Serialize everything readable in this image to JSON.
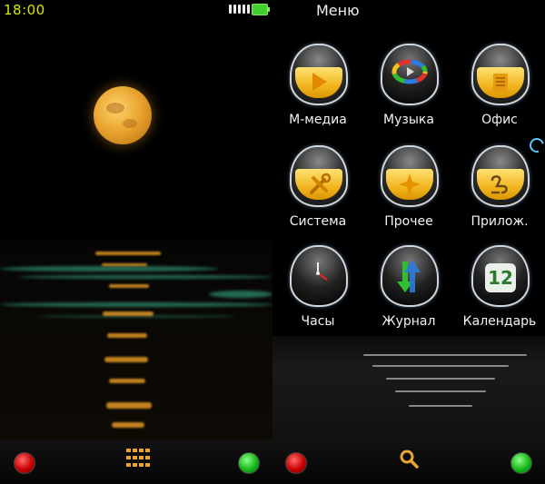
{
  "status": {
    "time": "18:00"
  },
  "menu": {
    "title": "Меню",
    "apps": [
      {
        "label": "М-медиа",
        "icon": "media-folder-icon"
      },
      {
        "label": "Музыка",
        "icon": "music-disc-icon"
      },
      {
        "label": "Офис",
        "icon": "office-document-icon"
      },
      {
        "label": "Система",
        "icon": "tools-icon"
      },
      {
        "label": "Прочее",
        "icon": "star-folder-icon"
      },
      {
        "label": "Прилож.",
        "icon": "apps-folder-icon"
      },
      {
        "label": "Часы",
        "icon": "clock-icon"
      },
      {
        "label": "Журнал",
        "icon": "log-arrows-icon"
      },
      {
        "label": "Календарь",
        "icon": "calendar-icon",
        "day": "12"
      }
    ]
  },
  "colors": {
    "time": "#d6e600",
    "accent": "#e8a533",
    "icon_fill": "#f2b51f"
  }
}
